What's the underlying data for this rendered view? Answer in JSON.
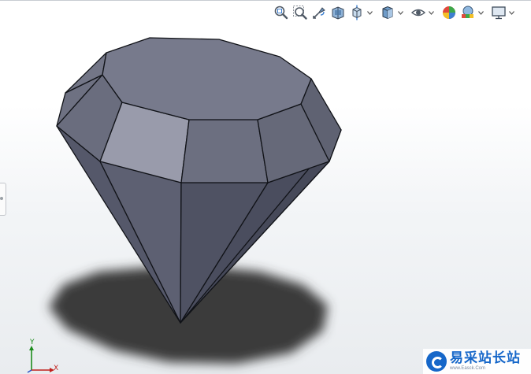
{
  "toolbar": {
    "buttons": [
      {
        "icon": "zoom-to-fit-icon"
      },
      {
        "icon": "zoom-to-area-icon"
      },
      {
        "icon": "previous-view-icon"
      },
      {
        "icon": "section-view-icon"
      },
      {
        "icon": "view-orientation-icon",
        "dropdown": true
      },
      {
        "icon": "display-style-icon",
        "dropdown": true
      },
      {
        "icon": "hide-show-items-icon",
        "dropdown": true
      },
      {
        "icon": "edit-appearance-icon"
      },
      {
        "icon": "apply-scene-icon",
        "dropdown": true
      },
      {
        "icon": "view-settings-icon",
        "dropdown": true
      }
    ]
  },
  "triad": {
    "y_label": "Y",
    "x_label": "X"
  },
  "watermark": {
    "title": "易采站长站",
    "subtitle": "www.Easck.Com"
  },
  "colors": {
    "facet_dark": "#5c5f6e",
    "facet_mid": "#6f7282",
    "facet_light": "#9a9cab",
    "shadow": "#3a3a3a",
    "triad_x": "#c0201c",
    "triad_y": "#1c8c1c",
    "watermark_blue": "#1667c9"
  }
}
